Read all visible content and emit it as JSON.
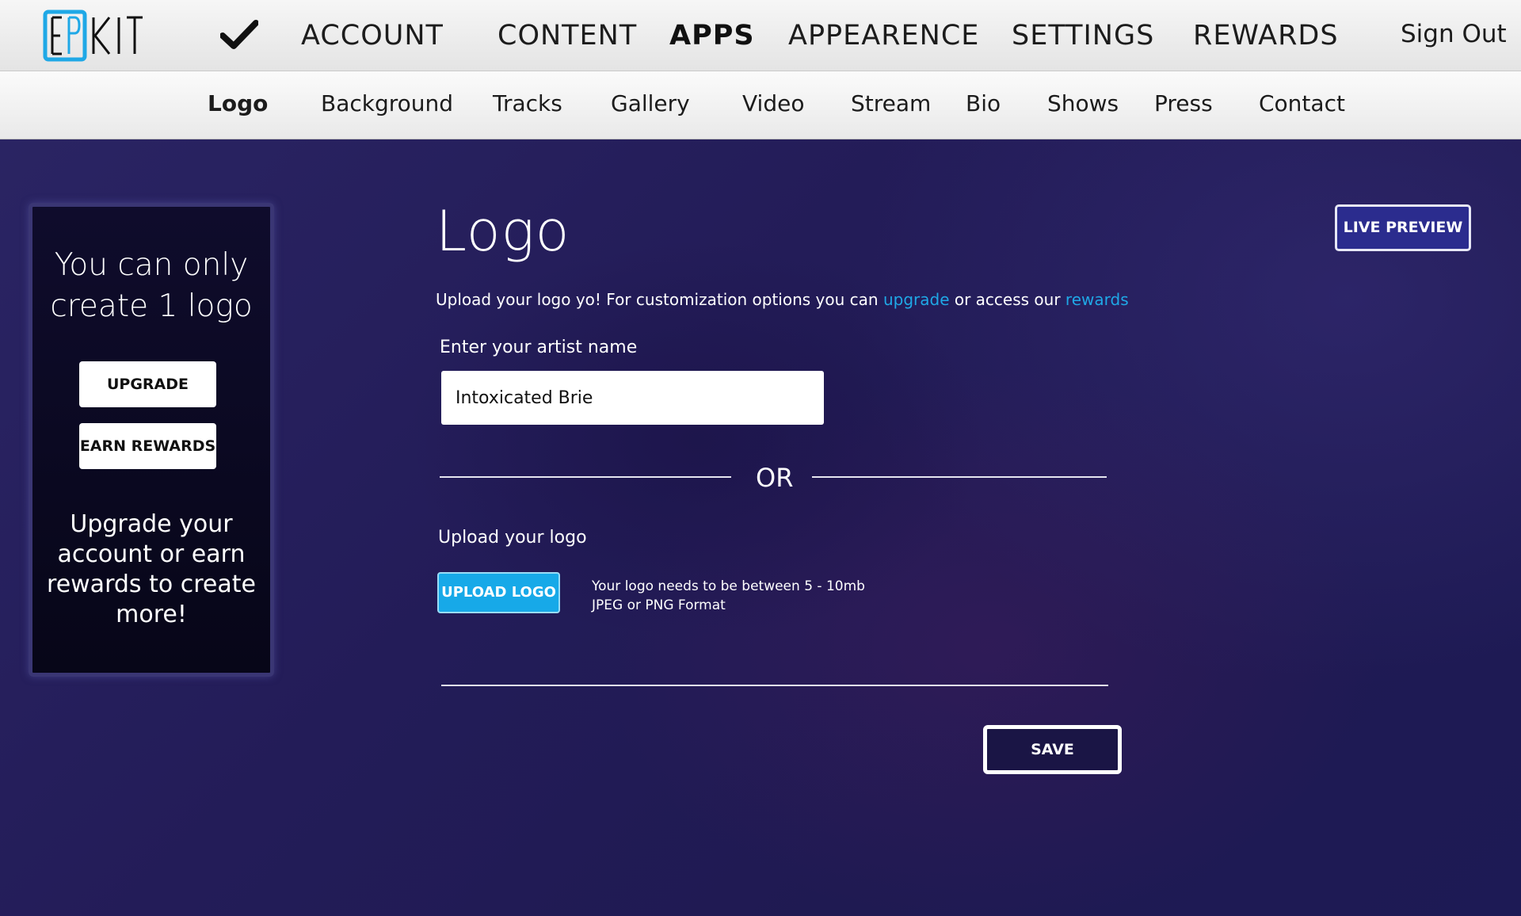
{
  "brand": {
    "logo_text": "EPKIT",
    "accent_color": "#1fa8e6"
  },
  "topnav": {
    "items": [
      {
        "label": "ACCOUNT",
        "active": false
      },
      {
        "label": "CONTENT",
        "active": false
      },
      {
        "label": "APPS",
        "active": true
      },
      {
        "label": "APPEARENCE",
        "active": false
      },
      {
        "label": "SETTINGS",
        "active": false
      },
      {
        "label": "REWARDS",
        "active": false
      }
    ],
    "sign_out": "Sign Out",
    "check_icon": "checkmark-icon"
  },
  "subnav": {
    "items": [
      {
        "label": "Logo",
        "active": true
      },
      {
        "label": "Background",
        "active": false
      },
      {
        "label": "Tracks",
        "active": false
      },
      {
        "label": "Gallery",
        "active": false
      },
      {
        "label": "Video",
        "active": false
      },
      {
        "label": "Stream",
        "active": false
      },
      {
        "label": "Bio",
        "active": false
      },
      {
        "label": "Shows",
        "active": false
      },
      {
        "label": "Press",
        "active": false
      },
      {
        "label": "Contact",
        "active": false
      }
    ]
  },
  "side": {
    "title": "You can only create 1 logo",
    "upgrade_label": "UPGRADE",
    "rewards_label": "EARN REWARDS",
    "text": "Upgrade your account or earn rewards to create more!"
  },
  "main": {
    "title": "Logo",
    "intro_prefix": "Upload your logo yo!  For customization options you can ",
    "intro_link1": "upgrade",
    "intro_mid": " or access our ",
    "intro_link2": "rewards",
    "name_label": "Enter your artist name",
    "name_value": "Intoxicated Brie",
    "or_text": "OR",
    "upload_label": "Upload your logo",
    "upload_button": "UPLOAD LOGO",
    "req_line1": "Your logo needs to be between 5 - 10mb",
    "req_line2": "JPEG or PNG Format",
    "save_button": "SAVE",
    "live_preview_button": "LIVE PREVIEW"
  }
}
